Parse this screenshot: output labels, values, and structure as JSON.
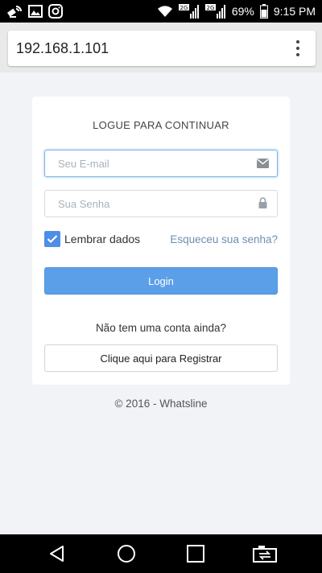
{
  "status_bar": {
    "battery": "69%",
    "time": "9:15 PM",
    "left_icons": [
      "satellite-icon",
      "image-icon",
      "instagram-icon"
    ],
    "right_icons": [
      "wifi-icon",
      "signal-2g-icon",
      "signal-2g-icon"
    ],
    "network_labels": [
      "2G",
      "2G"
    ]
  },
  "browser": {
    "url": "192.168.1.101",
    "menu_icon": "more-vert-icon"
  },
  "login_card": {
    "title": "LOGUE PARA CONTINUAR",
    "email": {
      "placeholder": "Seu E-mail",
      "value": "",
      "icon": "envelope-icon"
    },
    "password": {
      "placeholder": "Sua Senha",
      "value": "",
      "icon": "lock-icon"
    },
    "remember": {
      "label": "Lembrar dados",
      "checked": true
    },
    "forgot_link": "Esqueceu sua senha?",
    "login_button": "Login",
    "no_account_text": "Não tem uma conta ainda?",
    "register_button": "Clique aqui para Registrar"
  },
  "footer": {
    "text": "© 2016 - Whatsline"
  },
  "nav_bar": {
    "buttons": [
      "back-icon",
      "home-icon",
      "recents-icon",
      "screen-switch-icon"
    ]
  },
  "colors": {
    "accent": "#5b9fe8",
    "checkbox": "#4d8ee6",
    "link": "#6c8fb3",
    "page_background": "#f1f3f7"
  }
}
